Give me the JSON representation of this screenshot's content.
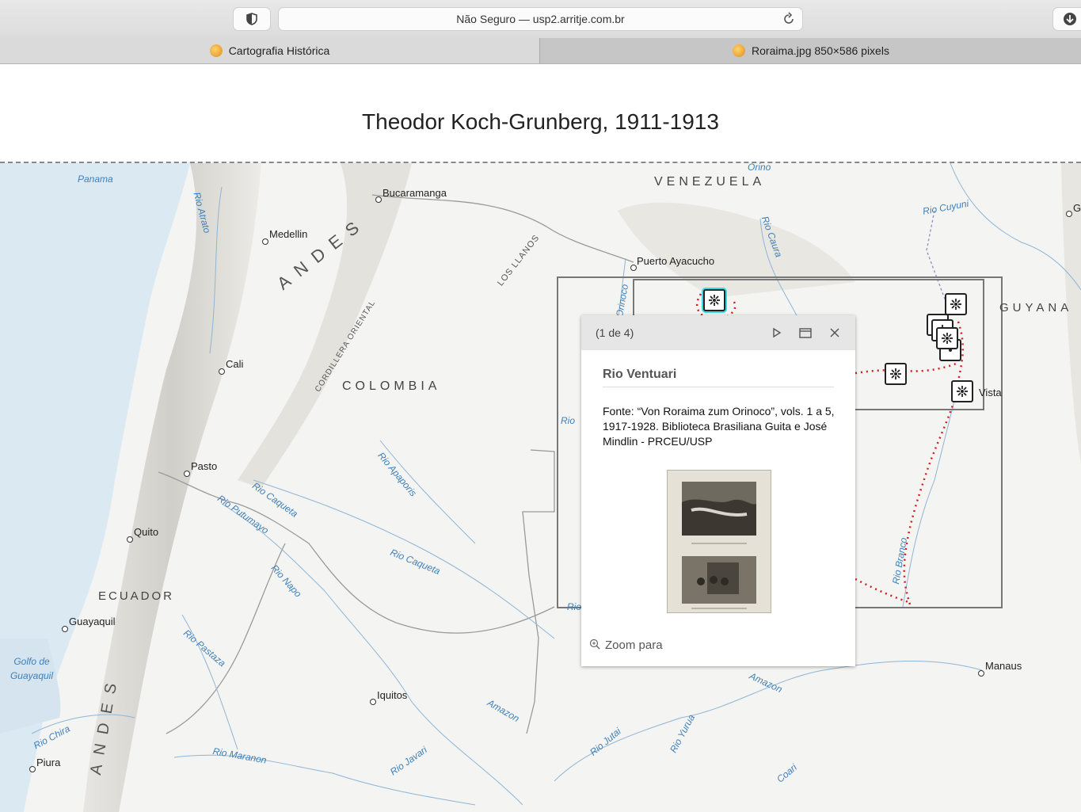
{
  "browser": {
    "url_text": "Não Seguro — usp2.arritje.com.br",
    "tabs": [
      {
        "label": "Cartografia Histórica"
      },
      {
        "label": "Roraima.jpg 850×586 pixels"
      }
    ]
  },
  "page": {
    "title": "Theodor Koch-Grunberg, 1911-1913"
  },
  "map": {
    "countries": [
      "VENEZUELA",
      "COLOMBIA",
      "ECUADOR",
      "GUYANA"
    ],
    "mountains": [
      "ANDES",
      "ANDES"
    ],
    "regions": [
      "LOS LLANOS",
      "CORDILLERA ORIENTAL"
    ],
    "cities": [
      "Bucaramanga",
      "Medellin",
      "Puerto Ayacucho",
      "Cali",
      "Pasto",
      "Quito",
      "Guayaquil",
      "Iquitos",
      "Piura",
      "Manaus",
      "G",
      "Vista"
    ],
    "rivers": [
      "Rio Atrato",
      "Rio Caura",
      "Rio Cuyuni",
      "Orinoco",
      "Rio",
      "Rio Apaporis",
      "Rio Caqueta",
      "Rio Putumayo",
      "Rio Caqueta",
      "Rio Napo",
      "Rio Pastaza",
      "Rio Chira",
      "Rio Maranon",
      "Rio Javari",
      "Amazon",
      "Rio Jutai",
      "Rio Yurua",
      "Coari",
      "Rio Branco",
      "Amazon",
      "Rio",
      "Orino"
    ],
    "water": [
      "Panama",
      "Golfo de Guayaquil"
    ],
    "colors": {
      "route": "#d21f1f",
      "land": "#f4f4f2",
      "sea": "#dbe9f3",
      "river_label": "#3f80b8"
    }
  },
  "popup": {
    "count": "(1 de 4)",
    "title": "Rio Ventuari",
    "text": "Fonte: “Von Roraima zum Orinoco”, vols. 1 a 5, 1917-1928. Biblioteca Brasiliana Guita e José Mindlin - PRCEU/USP",
    "zoom_label": "Zoom para"
  }
}
